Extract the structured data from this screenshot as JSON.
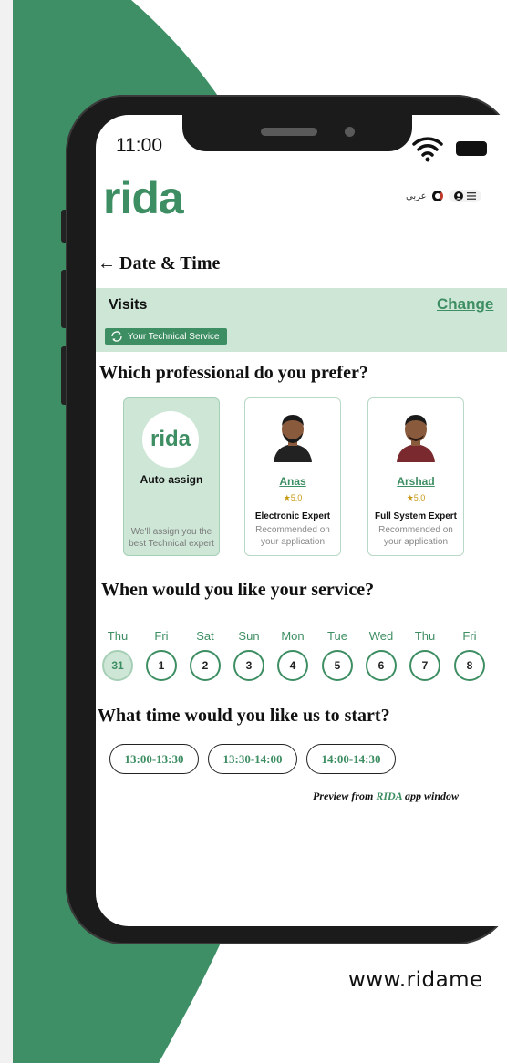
{
  "status_bar": {
    "time": "11:00"
  },
  "header": {
    "logo": "rida",
    "language": "عربي",
    "menu_icon": "menu-icon",
    "account_icon": "user-icon"
  },
  "page": {
    "title": "Date & Time"
  },
  "visits": {
    "title": "Visits",
    "change_label": "Change",
    "service_badge": "Your Technical Service"
  },
  "professional": {
    "heading": "Which professional do you prefer?",
    "cards": [
      {
        "name": "Auto assign",
        "line1": "We'll assign you the",
        "line2": "best Technical expert",
        "selected": true
      },
      {
        "name": "Anas",
        "rating": "5.0",
        "role": "Electronic Expert",
        "line1": "Recommended on",
        "line2": "your application"
      },
      {
        "name": "Arshad",
        "rating": "5.0",
        "role": "Full System Expert",
        "line1": "Recommended on",
        "line2": "your application"
      }
    ]
  },
  "service_date": {
    "heading": "When would you like your service?",
    "days": [
      {
        "name": "Thu",
        "date": "31",
        "selected": true
      },
      {
        "name": "Fri",
        "date": "1"
      },
      {
        "name": "Sat",
        "date": "2"
      },
      {
        "name": "Sun",
        "date": "3"
      },
      {
        "name": "Mon",
        "date": "4"
      },
      {
        "name": "Tue",
        "date": "5"
      },
      {
        "name": "Wed",
        "date": "6"
      },
      {
        "name": "Thu",
        "date": "7"
      },
      {
        "name": "Fri",
        "date": "8"
      }
    ]
  },
  "start_time": {
    "heading": "What time would you like us to start?",
    "slots": [
      "13:00-13:30",
      "13:30-14:00",
      "14:00-14:30"
    ]
  },
  "preview_note": {
    "prefix": "Preview from",
    "brand": "RIDA",
    "suffix": "app window"
  },
  "website": "www.ridame",
  "colors": {
    "brand_green": "#3e8e63",
    "light_green": "#cde6d6",
    "background_green": "#3f8f66"
  }
}
